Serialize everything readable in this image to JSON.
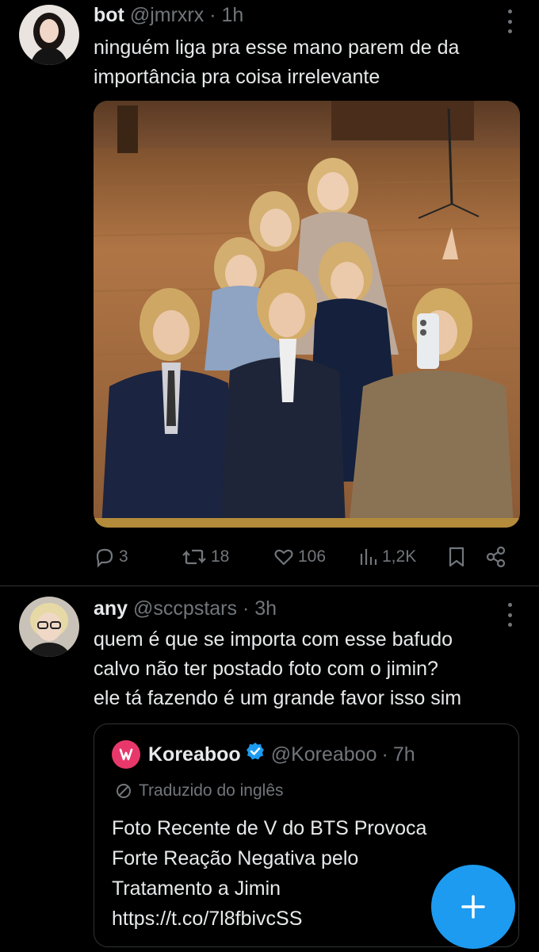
{
  "tweet1": {
    "name": "bot",
    "handle": "@jmrxrx",
    "separator": "·",
    "time": "1h",
    "text_lines": [
      "ninguém liga pra esse mano parem de da",
      "importância pra coisa irrelevante"
    ],
    "actions": {
      "replies": "3",
      "retweets": "18",
      "likes": "106",
      "views": "1,2K"
    }
  },
  "tweet2": {
    "name": "any",
    "handle": "@sccpstars",
    "separator": "·",
    "time": "3h",
    "text_lines": [
      "quem é que se importa com esse bafudo",
      "calvo não ter postado foto com o jimin?",
      "ele tá fazendo é um grande favor isso sim"
    ],
    "quote": {
      "name": "Koreaboo",
      "handle": "@Koreaboo",
      "separator": "·",
      "time": "7h",
      "translated_label": "Traduzido do inglês",
      "text_lines": [
        "Foto Recente de V do BTS Provoca",
        "Forte Reação Negativa pelo",
        "Tratamento a Jimin",
        "https://t.co/7l8fbivcSS"
      ]
    }
  },
  "fab_label": "+",
  "colors": {
    "background": "#000000",
    "text": "#e7e9ea",
    "muted": "#71767b",
    "accent": "#1d9bf0",
    "border": "#2f3336",
    "koreaboo": "#e8386b"
  },
  "icons": [
    "reply-icon",
    "retweet-icon",
    "like-icon",
    "views-icon",
    "bookmark-icon",
    "share-icon",
    "verified-icon",
    "translate-icon",
    "plus-icon"
  ]
}
